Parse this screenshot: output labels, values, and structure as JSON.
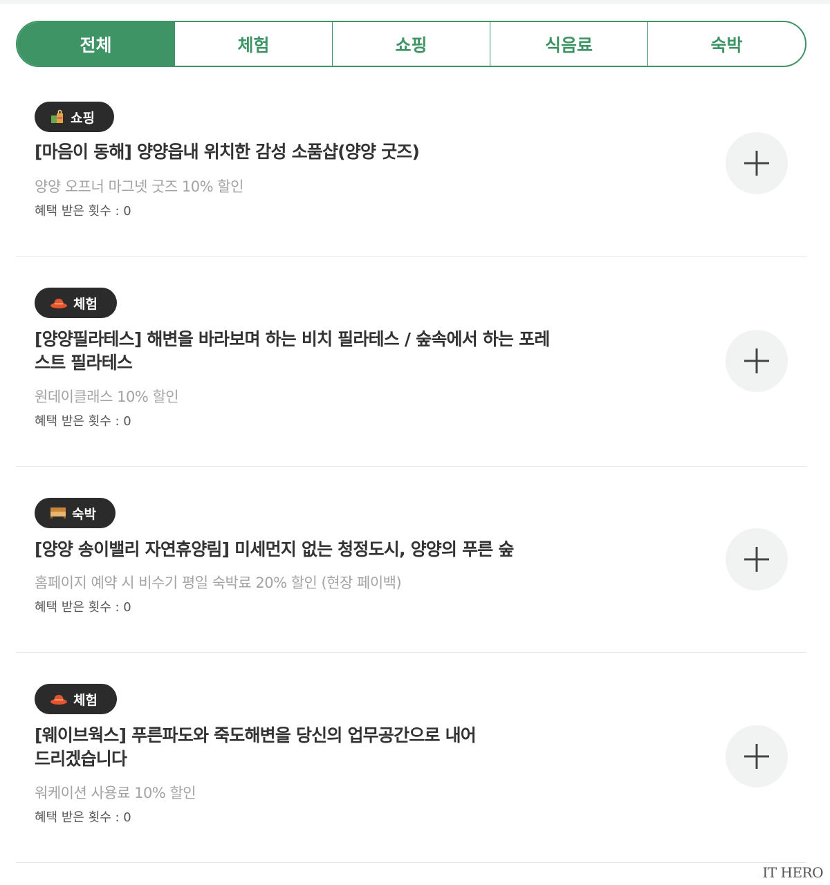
{
  "tabs": [
    {
      "label": "전체",
      "active": true
    },
    {
      "label": "체험",
      "active": false
    },
    {
      "label": "쇼핑",
      "active": false
    },
    {
      "label": "식음료",
      "active": false
    },
    {
      "label": "숙박",
      "active": false
    }
  ],
  "items": [
    {
      "category": "쇼핑",
      "category_icon": "shopping-bag-icon",
      "title": "[마음이 동해] 양양읍내 위치한 감성 소품샵(양양 굿즈)",
      "benefit": "양양 오프너 마그넷 굿즈 10% 할인",
      "usage_count": "혜택 받은 횟수 : 0"
    },
    {
      "category": "체험",
      "category_icon": "hat-icon",
      "title": "[양양필라테스] 해변을 바라보며 하는 비치 필라테스 / 숲속에서 하는 포레스트 필라테스",
      "benefit": "원데이클래스 10% 할인",
      "usage_count": "혜택 받은 횟수 : 0"
    },
    {
      "category": "숙박",
      "category_icon": "bed-icon",
      "title": "[양양 송이밸리 자연휴양림] 미세먼지 없는 청정도시, 양양의 푸른 숲",
      "benefit": "홈페이지 예약 시 비수기 평일 숙박료 20% 할인 (현장 페이백)",
      "usage_count": "혜택 받은 횟수 : 0"
    },
    {
      "category": "체험",
      "category_icon": "hat-icon",
      "title": "[웨이브웍스] 푸른파도와 죽도해변을 당신의 업무공간으로 내어드리겠습니다",
      "benefit": "워케이션 사용료 10% 할인",
      "usage_count": "혜택 받은 횟수 : 0"
    }
  ],
  "watermark": "IT HERO",
  "colors": {
    "accent": "#3f9465",
    "badge_bg": "#2b2b2b",
    "divider": "#e6e6e6",
    "plus_bg": "#f1f2f2"
  }
}
